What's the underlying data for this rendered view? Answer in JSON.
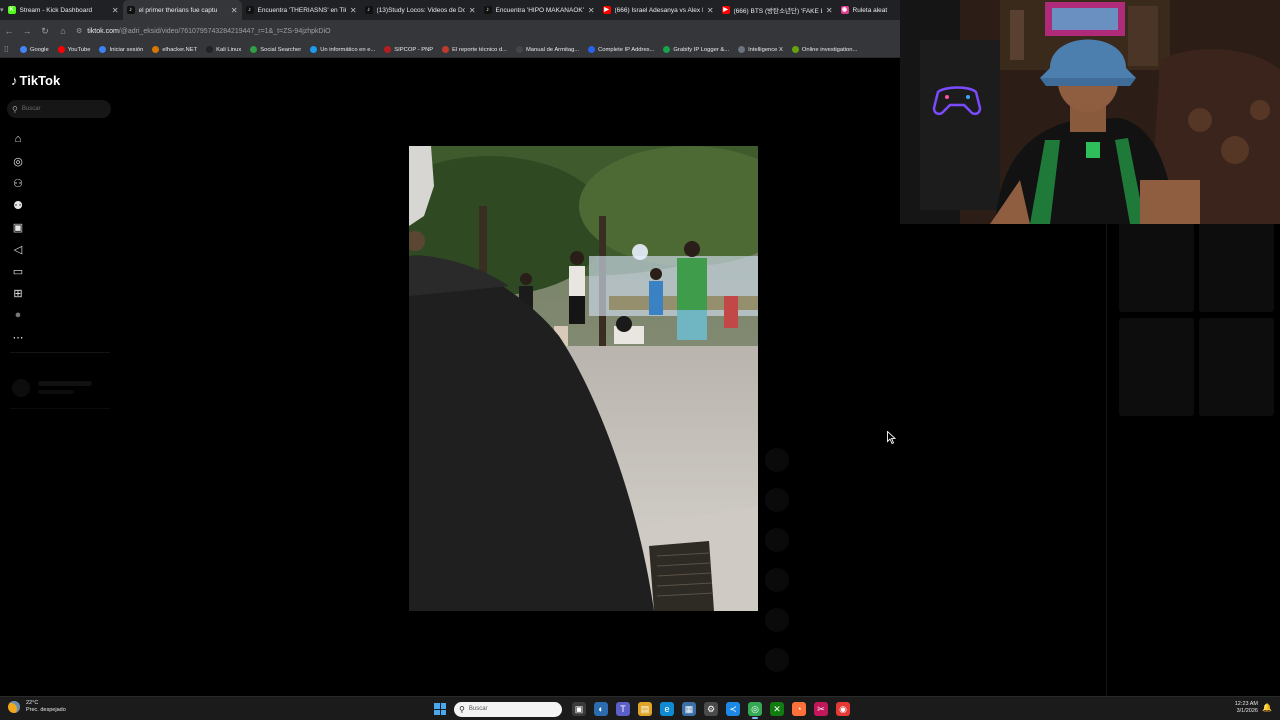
{
  "browser": {
    "tabs": [
      {
        "title": "Stream - Kick Dashboard",
        "favicon": "kick-icon",
        "color": "#53fc18",
        "letter": "K",
        "active": false
      },
      {
        "title": "el primer therians fue captu",
        "favicon": "tiktok-icon",
        "color": "#111111",
        "letter": "♪",
        "active": true
      },
      {
        "title": "Encuentra 'THERIASNS' en TikT",
        "favicon": "tiktok-icon",
        "color": "#111111",
        "letter": "♪",
        "active": false
      },
      {
        "title": "(13)Study Locos: Videos de Dor",
        "favicon": "tiktok-icon",
        "color": "#111111",
        "letter": "♪",
        "active": false
      },
      {
        "title": "Encuentra 'HIPO MAKANAOK'",
        "favicon": "tiktok-icon",
        "color": "#111111",
        "letter": "♪",
        "active": false
      },
      {
        "title": "(666) Israel Adesanya vs Alex P",
        "favicon": "youtube-icon",
        "color": "#ff0000",
        "letter": "▶",
        "active": false
      },
      {
        "title": "(666) BTS (방탄소년단) 'FAKE LO",
        "favicon": "youtube-icon",
        "color": "#ff0000",
        "letter": "▶",
        "active": false
      },
      {
        "title": "Ruleta aleat",
        "favicon": "wheel-icon",
        "color": "#e23d8f",
        "letter": "◉",
        "active": false
      }
    ],
    "url_host": "tiktok.com",
    "url_path": "/@adri_eksid/video/7610795743284219447_r=1&_t=ZS-94jzhpkDiO",
    "bookmarks": [
      {
        "label": "Google",
        "color": "#4285f4"
      },
      {
        "label": "YouTube",
        "color": "#ff0000"
      },
      {
        "label": "Iniciar sesión",
        "color": "#3b82f6"
      },
      {
        "label": "elhacker.NET",
        "color": "#d97706"
      },
      {
        "label": "Kali Linux",
        "color": "#222222"
      },
      {
        "label": "Social Searcher",
        "color": "#2f9e44"
      },
      {
        "label": "Un informático en e...",
        "color": "#1d9bf0"
      },
      {
        "label": "SIPCOP - PNP",
        "color": "#b91c1c"
      },
      {
        "label": "El reporte técnico d...",
        "color": "#c0392b"
      },
      {
        "label": "Manual de Armitag...",
        "color": "#444444"
      },
      {
        "label": "Complete IP Addres...",
        "color": "#2563eb"
      },
      {
        "label": "Grabify IP Logger &...",
        "color": "#16a34a"
      },
      {
        "label": "Intelligence X",
        "color": "#6b7280"
      },
      {
        "label": "Online investigation...",
        "color": "#65a30d"
      }
    ]
  },
  "tiktok": {
    "logo_text": "TikTok",
    "search_placeholder": "Buscar",
    "sidebar_icons": [
      "home-icon",
      "explore-icon",
      "following-icon",
      "friends-icon",
      "live-icon",
      "messages-icon",
      "inbox-icon",
      "upload-icon",
      "profile-icon",
      "more-icon"
    ]
  },
  "taskbar": {
    "weather_temp": "22°C",
    "weather_desc": "Prec. despejado",
    "search_placeholder": "Buscar",
    "time": "12:23 AM",
    "date": "3/1/2026",
    "apps": [
      {
        "name": "task-view-icon",
        "color": "#3a3a3a",
        "glyph": "▣",
        "active": false
      },
      {
        "name": "copilot-icon",
        "color": "#2b6cb0",
        "glyph": "◐",
        "active": false
      },
      {
        "name": "teams-icon",
        "color": "#5b5fc7",
        "glyph": "T",
        "active": false
      },
      {
        "name": "file-explorer-icon",
        "color": "#e0a526",
        "glyph": "▤",
        "active": false
      },
      {
        "name": "edge-icon",
        "color": "#0f8bd4",
        "glyph": "e",
        "active": false
      },
      {
        "name": "store-icon",
        "color": "#3a6ea5",
        "glyph": "▦",
        "active": false
      },
      {
        "name": "settings-icon",
        "color": "#4a4a4a",
        "glyph": "⚙",
        "active": false
      },
      {
        "name": "vscode-icon",
        "color": "#1e88e5",
        "glyph": "≺",
        "active": false
      },
      {
        "name": "chrome-icon",
        "color": "#34a853",
        "glyph": "◎",
        "active": true
      },
      {
        "name": "xbox-icon",
        "color": "#107c10",
        "glyph": "✕",
        "active": false
      },
      {
        "name": "firefox-icon",
        "color": "#ff7139",
        "glyph": "◔",
        "active": false
      },
      {
        "name": "snipping-icon",
        "color": "#c2185b",
        "glyph": "✂",
        "active": false
      },
      {
        "name": "obs-icon",
        "color": "#e53935",
        "glyph": "◉",
        "active": false
      }
    ]
  }
}
